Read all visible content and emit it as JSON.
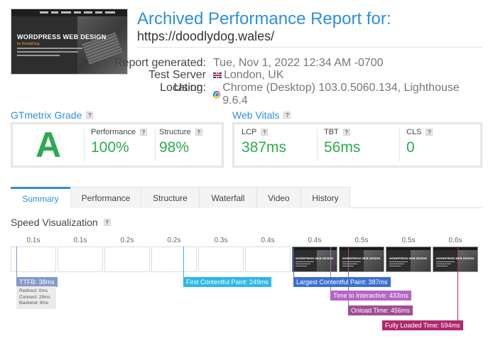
{
  "header": {
    "title": "Archived Performance Report for:",
    "url": "https://doodlydog.wales/",
    "thumbnail": {
      "headline": "WORDPRESS WEB DESIGN",
      "subline": "by DoodlyDog"
    },
    "meta": [
      {
        "label": "Report generated:",
        "value": "Tue, Nov 1, 2022 12:34 AM -0700",
        "icon": ""
      },
      {
        "label": "Test Server Location:",
        "value": "London, UK",
        "icon": "uk-flag-icon"
      },
      {
        "label": "Using:",
        "value": "Chrome (Desktop) 103.0.5060.134, Lighthouse 9.6.4",
        "icon": "chrome-icon"
      }
    ]
  },
  "grade": {
    "heading": "GTmetrix Grade",
    "letter": "A",
    "metrics": [
      {
        "label": "Performance",
        "value": "100%"
      },
      {
        "label": "Structure",
        "value": "98%"
      }
    ]
  },
  "vitals": {
    "heading": "Web Vitals",
    "metrics": [
      {
        "label": "LCP",
        "value": "387ms"
      },
      {
        "label": "TBT",
        "value": "56ms"
      },
      {
        "label": "CLS",
        "value": "0"
      }
    ]
  },
  "tabs": [
    {
      "label": "Summary",
      "active": true
    },
    {
      "label": "Performance",
      "active": false
    },
    {
      "label": "Structure",
      "active": false
    },
    {
      "label": "Waterfall",
      "active": false
    },
    {
      "label": "Video",
      "active": false
    },
    {
      "label": "History",
      "active": false
    }
  ],
  "speed": {
    "heading": "Speed Visualization",
    "timestamps": [
      "0.1s",
      "0.1s",
      "0.2s",
      "0.2s",
      "0.3s",
      "0.4s",
      "0.4s",
      "0.5s",
      "0.5s",
      "0.6s"
    ],
    "frame_text": "WORDPRESS WEB DESIGN",
    "markers": {
      "ttfb": "TTFB: 38ms",
      "fcp": "First Contentful Paint: 249ms",
      "lcp": "Largest Contentful Paint: 387ms",
      "tti": "Time to Interactive: 433ms",
      "onload": "Onload Time: 456ms",
      "full": "Fully Loaded Time: 594ms"
    },
    "ttfb_detail": {
      "redirect": "Redirect: 0ms",
      "connect": "Connect: 29ms",
      "backend": "Backend: 9ms"
    }
  },
  "colors": {
    "accent": "#2c8fe0",
    "grade_green": "#2daa4e",
    "ttfb": "#8599c9",
    "fcp": "#2db8e8",
    "lcp": "#3c6fd4",
    "tti": "#b564c8",
    "onload": "#a04e96",
    "fully_loaded": "#b0286e"
  }
}
